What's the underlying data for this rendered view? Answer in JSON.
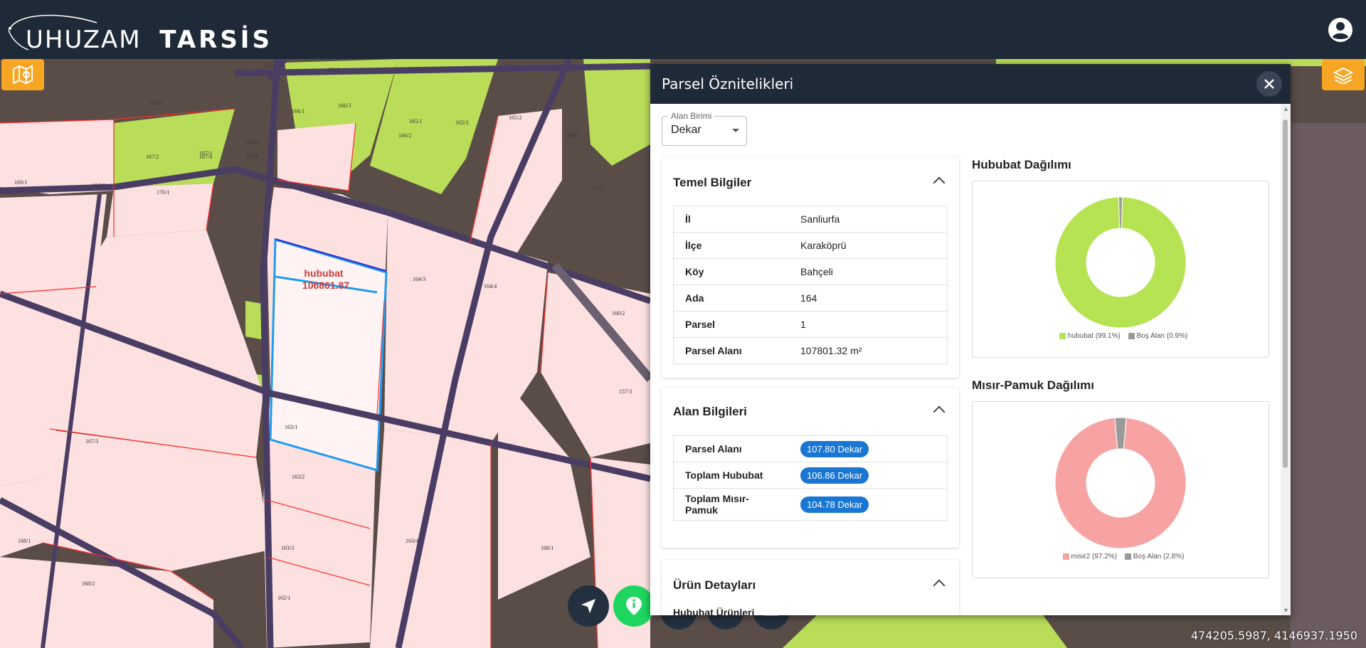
{
  "app": {
    "logo_main": "UHUZAM",
    "logo_product": "TARSİS"
  },
  "map": {
    "coordinates": "474205.5987, 4146937.1950",
    "selected_label": "hububat",
    "selected_value": "106861.87",
    "parcel_labels": [
      "153/1",
      "153/2",
      "152/2",
      "166/1",
      "166/3",
      "166/2",
      "165/1",
      "165/3",
      "165/2",
      "166/1",
      "167/4",
      "167/1",
      "167/4",
      "167/2",
      "169/1",
      "170/1",
      "164/1",
      "164/2",
      "164/3",
      "164/4",
      "163/1",
      "163/2",
      "163/3",
      "163/4",
      "162/1",
      "160/1",
      "160/2",
      "157/2",
      "157/3",
      "168/1",
      "168/2",
      "167/3"
    ],
    "colors": {
      "parcel_fill": "#fde0e0",
      "crop_fill": "#b9dd58",
      "boundary": "#ff2a2a",
      "road": "#4a3d64",
      "selection": "#1e9bf0"
    }
  },
  "panel": {
    "title": "Parsel Öznitelikleri",
    "unit_label": "Alan Birimi",
    "unit_value": "Dekar",
    "basic": {
      "title": "Temel Bilgiler",
      "rows": [
        {
          "key": "İl",
          "value": "Sanliurfa"
        },
        {
          "key": "İlçe",
          "value": "Karaköprü"
        },
        {
          "key": "Köy",
          "value": "Bahçeli"
        },
        {
          "key": "Ada",
          "value": "164"
        },
        {
          "key": "Parsel",
          "value": "1"
        },
        {
          "key": "Parsel Alanı",
          "value": "107801.32 m²"
        }
      ]
    },
    "area": {
      "title": "Alan Bilgileri",
      "rows": [
        {
          "key": "Parsel Alanı",
          "value": "107.80 Dekar"
        },
        {
          "key": "Toplam Hububat",
          "value": "106.86 Dekar"
        },
        {
          "key": "Toplam Mısır-Pamuk",
          "value": "104.78 Dekar"
        }
      ]
    },
    "products": {
      "title": "Ürün Detayları",
      "subtitle": "Hububat Ürünleri"
    }
  },
  "chart_data": [
    {
      "type": "pie",
      "title": "Hububat Dağılımı",
      "categories": [
        "hububat (99.1%)",
        "Boş Alan (0.9%)"
      ],
      "values": [
        99.1,
        0.9
      ],
      "colors": [
        "#b5e353",
        "#9a9a9a"
      ],
      "legend": "bottom"
    },
    {
      "type": "pie",
      "title": "Mısır-Pamuk Dağılımı",
      "categories": [
        "misir2 (97.2%)",
        "Boş Alan (2.8%)"
      ],
      "values": [
        97.2,
        2.8
      ],
      "colors": [
        "#f7a3a3",
        "#9a9a9a"
      ],
      "legend": "bottom"
    }
  ]
}
